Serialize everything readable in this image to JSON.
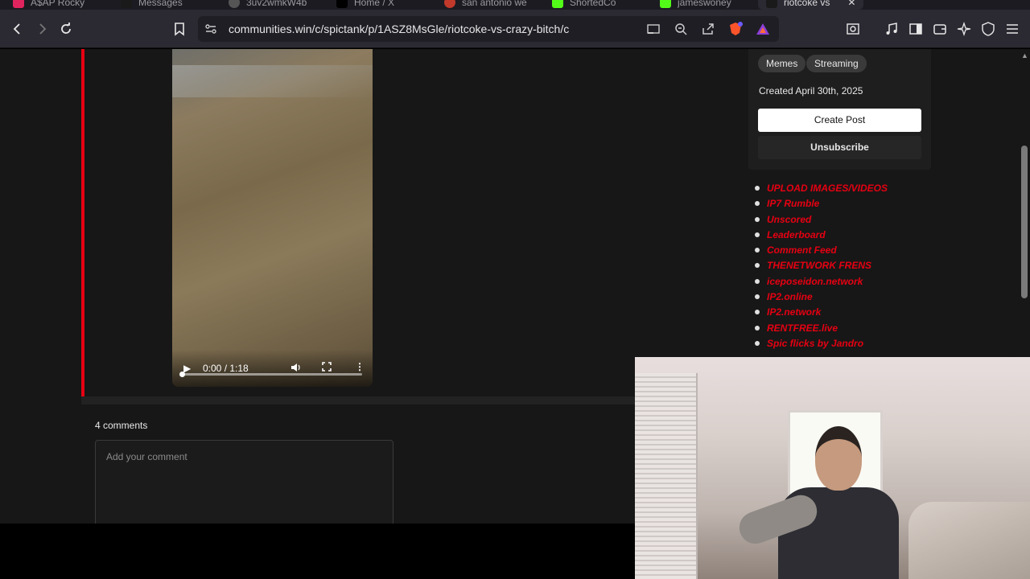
{
  "browser": {
    "tabs": [
      {
        "label": "A$AP Rocky",
        "favicon_color": "#e0245e"
      },
      {
        "label": "Messages",
        "favicon_color": "#1a1a1a"
      },
      {
        "label": "3uv2wmkW4b",
        "favicon_color": "#555555"
      },
      {
        "label": "Home / X",
        "favicon_color": "#000000"
      },
      {
        "label": "san antonio we",
        "favicon_color": "#c0392b"
      },
      {
        "label": "ShortedCo",
        "favicon_color": "#53fc18"
      },
      {
        "label": "jameswoney",
        "favicon_color": "#53fc18"
      },
      {
        "label": "riotcoke vs",
        "favicon_color": "#1a1a1a"
      }
    ],
    "url": "communities.win/c/spictank/p/1ASZ8MsGle/riotcoke-vs-crazy-bitch/c"
  },
  "video": {
    "time": "0:00 / 1:18",
    "progress": 0.0
  },
  "comments": {
    "count_label": "4 comments",
    "placeholder": "Add your comment"
  },
  "sidebar": {
    "tags": [
      "Memes",
      "Streaming"
    ],
    "created": "Created April 30th, 2025",
    "create_post_label": "Create Post",
    "unsubscribe_label": "Unsubscribe",
    "links": [
      "UPLOAD IMAGES/VIDEOS",
      "IP7 Rumble",
      "Unscored",
      "Leaderboard",
      "Comment Feed",
      "THENETWORK FRENS",
      "iceposeidon.network",
      "IP2.online",
      "IP2.network",
      "RENTFREE.live",
      "Spic flicks by Jandro"
    ]
  },
  "colors": {
    "accent_red": "#e60012",
    "page_bg": "#171717"
  }
}
